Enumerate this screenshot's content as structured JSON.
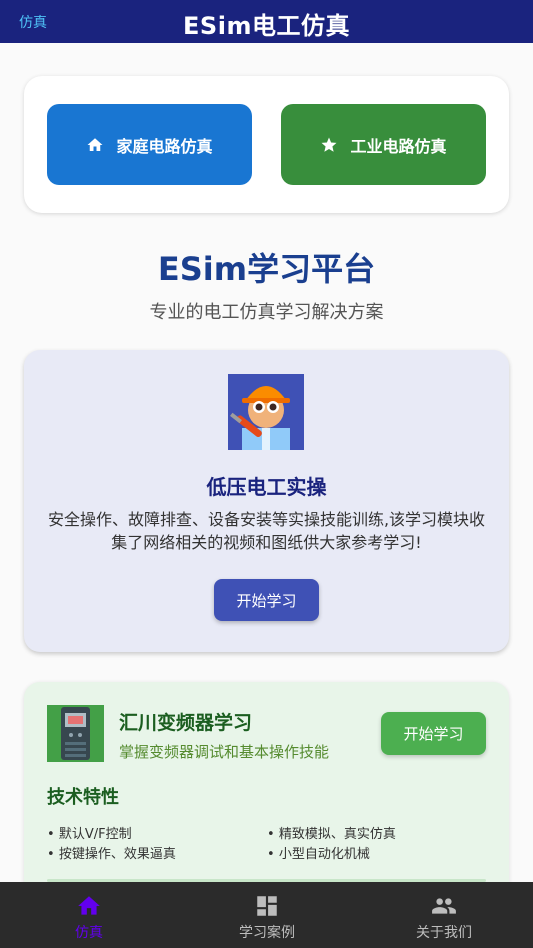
{
  "topbar": {
    "back_label": "仿真",
    "title": "ESim电工仿真"
  },
  "mode_buttons": [
    {
      "label": "家庭电路仿真",
      "icon": "home-icon",
      "color": "#1976d2"
    },
    {
      "label": "工业电路仿真",
      "icon": "star-icon",
      "color": "#388e3c"
    }
  ],
  "platform": {
    "title": "ESim学习平台",
    "subtitle": "专业的电工仿真学习解决方案"
  },
  "low_voltage": {
    "image_icon": "electrician-avatar-icon",
    "title": "低压电工实操",
    "description": "安全操作、故障排查、设备安装等实操技能训练,该学习模块收集了网络相关的视频和图纸供大家参考学习!",
    "button": "开始学习"
  },
  "inverter": {
    "image_icon": "inverter-device-icon",
    "title": "汇川变频器学习",
    "subtitle": "掌握变频器调试和基本操作技能",
    "button": "开始学习",
    "features_title": "技术特性",
    "features": [
      "默认V/F控制",
      "精致模拟、真实仿真",
      "按键操作、效果逼真",
      "小型自动化机械"
    ]
  },
  "bottom_nav": {
    "items": [
      {
        "label": "仿真",
        "icon": "home-icon",
        "active": true
      },
      {
        "label": "学习案例",
        "icon": "dashboard-icon",
        "active": false
      },
      {
        "label": "关于我们",
        "icon": "people-icon",
        "active": false
      }
    ]
  },
  "colors": {
    "topbar": "#1a237e",
    "accent_active": "#6200ee",
    "platform_title": "#1a3f8f"
  }
}
